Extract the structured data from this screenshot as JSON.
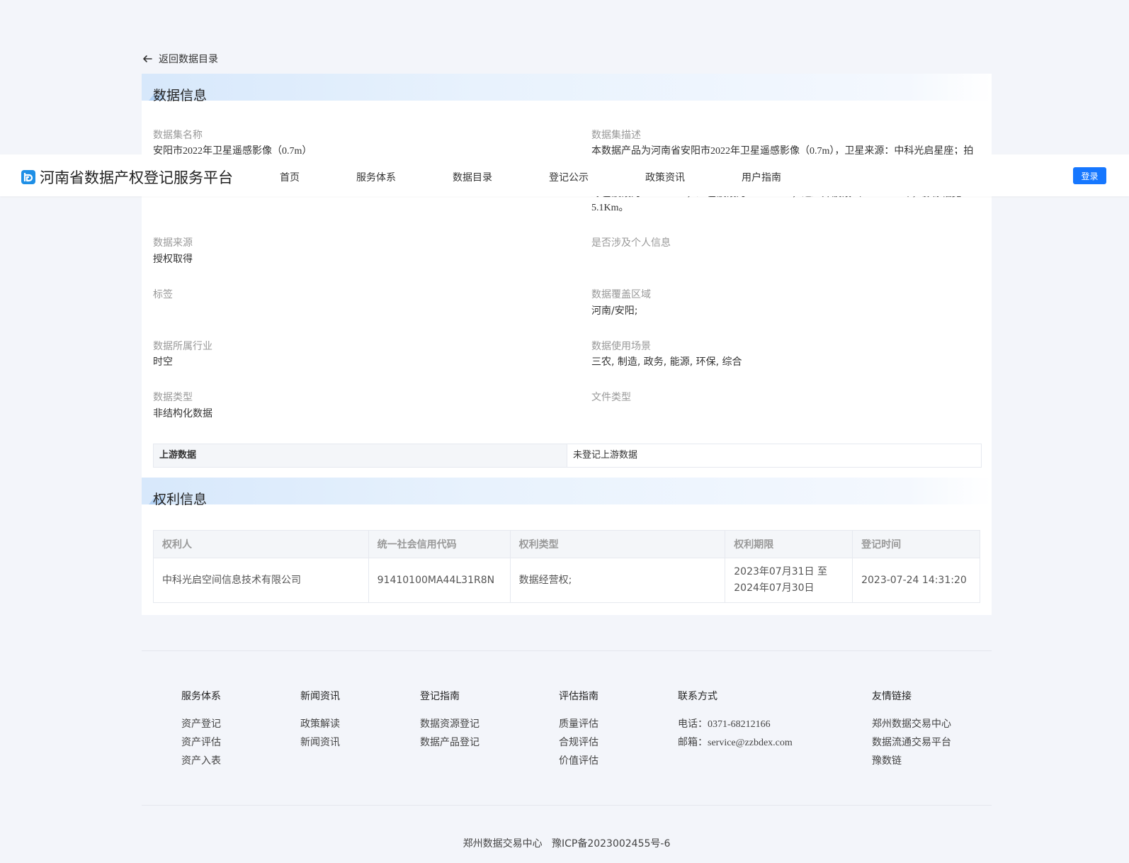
{
  "back": {
    "label": "返回数据目录"
  },
  "data_info": {
    "title": "数据信息",
    "fields": {
      "dataset_name": {
        "label": "数据集名称",
        "value": "安阳市2022年卫星遥感影像（0.7m）"
      },
      "dataset_desc": {
        "label": "数据集描述",
        "line1": "本数据产品为河南省安阳市2022年卫星遥感影像（0.7m），卫星来源：中科光启星座；拍",
        "line3": "绿色波段为515-580nm，红色波段为630-690nm，近红外波段（750-900nm），影像幅宽：",
        "line4": "5.1Km。"
      },
      "source": {
        "label": "数据来源",
        "value": "授权取得"
      },
      "personal_info": {
        "label": "是否涉及个人信息",
        "value": ""
      },
      "tags": {
        "label": "标签",
        "value": ""
      },
      "coverage": {
        "label": "数据覆盖区域",
        "value": "河南/安阳;"
      },
      "industry": {
        "label": "数据所属行业",
        "value": "时空"
      },
      "scenarios": {
        "label": "数据使用场景",
        "value": "三农, 制造, 政务, 能源, 环保, 综合"
      },
      "data_type": {
        "label": "数据类型",
        "value": "非结构化数据"
      },
      "file_type": {
        "label": "文件类型",
        "value": ""
      }
    },
    "upstream": {
      "label": "上游数据",
      "value": "未登记上游数据"
    }
  },
  "rights_info": {
    "title": "权利信息",
    "columns": [
      "权利人",
      "统一社会信用代码",
      "权利类型",
      "权利期限",
      "登记时间"
    ],
    "rows": [
      {
        "holder": "中科光启空间信息技术有限公司",
        "code": "91410100MA44L31R8N",
        "type": "数据经营权;",
        "term_line1": "2023年07月31日 至",
        "term_line2": "2024年07月30日",
        "time": "2023-07-24 14:31:20"
      }
    ]
  },
  "navbar": {
    "brand": "河南省数据产权登记服务平台",
    "items": [
      "首页",
      "服务体系",
      "数据目录",
      "登记公示",
      "政策资讯",
      "用户指南"
    ],
    "login": "登录"
  },
  "footer": {
    "columns": [
      {
        "title": "服务体系",
        "links": [
          "资产登记",
          "资产评估",
          "资产入表"
        ]
      },
      {
        "title": "新闻资讯",
        "links": [
          "政策解读",
          "新闻资讯"
        ]
      },
      {
        "title": "登记指南",
        "links": [
          "数据资源登记",
          "数据产品登记"
        ]
      },
      {
        "title": "评估指南",
        "links": [
          "质量评估",
          "合规评估",
          "价值评估"
        ]
      },
      {
        "title": "联系方式",
        "phone_label": "电话：",
        "phone": "0371-68212166",
        "email_label": "邮箱：",
        "email": "service@zzbdex.com"
      },
      {
        "title": "友情链接",
        "links": [
          "郑州数据交易中心",
          "数据流通交易平台",
          "豫数链"
        ]
      }
    ],
    "copyright": "郑州数据交易中心   豫ICP备2023002455号-6"
  },
  "colors": {
    "accent": "#1677ff",
    "page_bg": "#f3f5fa",
    "section_header_bg": "#e3effc"
  }
}
